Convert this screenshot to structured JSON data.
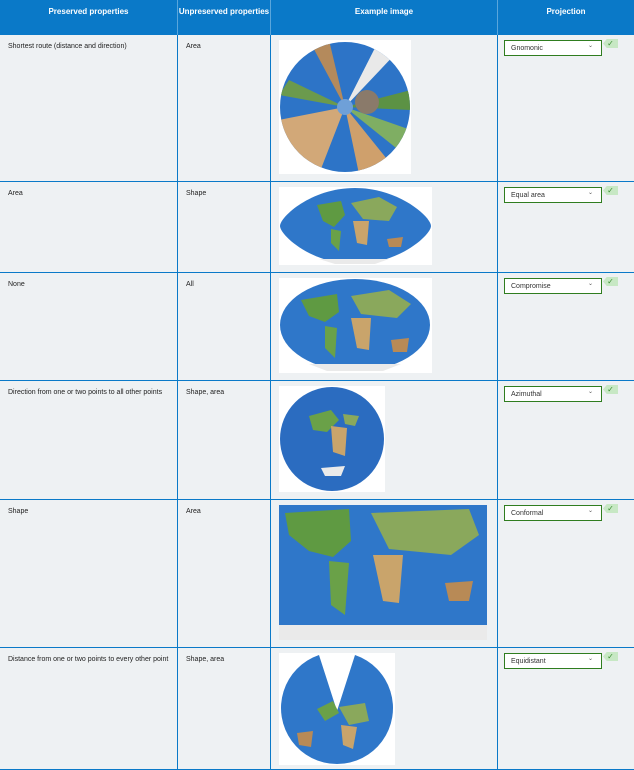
{
  "header": {
    "col1": "Preserved properties",
    "col2": "Unpreserved properties",
    "col3": "Example image",
    "col4": "Projection"
  },
  "rows": [
    {
      "preserved": "Shortest route (distance and direction)",
      "unpreserved": "Area",
      "projection": "Gnomonic"
    },
    {
      "preserved": "Area",
      "unpreserved": "Shape",
      "projection": "Equal area"
    },
    {
      "preserved": "None",
      "unpreserved": "All",
      "projection": "Compromise"
    },
    {
      "preserved": "Direction from one or two points to all other points",
      "unpreserved": "Shape, area",
      "projection": "Azimuthal"
    },
    {
      "preserved": "Shape",
      "unpreserved": "Area",
      "projection": "Conformal"
    },
    {
      "preserved": "Distance from one or two points to every other point",
      "unpreserved": "Shape, area",
      "projection": "Equidistant"
    }
  ],
  "colors": {
    "header": "#0a79c8",
    "border": "#0a79c8",
    "cell_bg": "#eef1f3",
    "select_border": "#2f7d1f",
    "check_bg": "#c7e8c4",
    "ocean": "#2a6fc0",
    "land": "#5d9a3f"
  },
  "icons": {
    "dropdown": "chevron-down-icon",
    "check": "check-icon"
  },
  "check_glyph": "✓",
  "chevron_glyph": "⌄"
}
